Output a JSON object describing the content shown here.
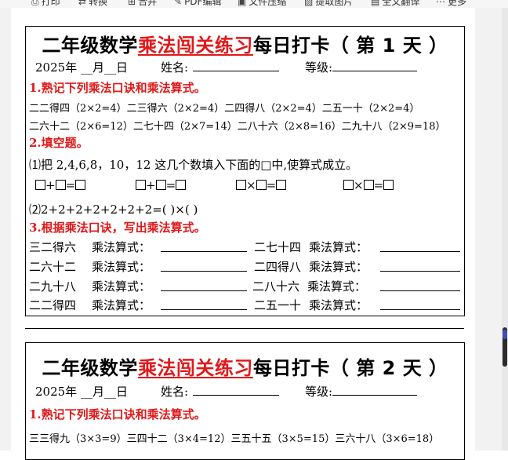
{
  "toolbar": {
    "items": [
      {
        "icon": "print-icon",
        "glyph": "⎙",
        "label": "打印"
      },
      {
        "icon": "convert-icon",
        "glyph": "⇄",
        "label": "转换"
      },
      {
        "icon": "merge-icon",
        "glyph": "⊞",
        "label": "合并"
      },
      {
        "icon": "pdf-edit-icon",
        "glyph": "✎",
        "label": "PDF编辑"
      },
      {
        "icon": "compress-icon",
        "glyph": "▣",
        "label": "文件压缩"
      },
      {
        "icon": "extract-image-icon",
        "glyph": "▨",
        "label": "提取图片"
      },
      {
        "icon": "translate-icon",
        "glyph": "▤",
        "label": "全文翻译"
      },
      {
        "icon": "more-icon",
        "glyph": "⋯",
        "label": "更多"
      }
    ]
  },
  "day1": {
    "title_pre": "二年级数学",
    "title_red": "乘法闯关练习",
    "title_post": "每日打卡（ 第 1 天 ）",
    "date_label": "2025年 __月__日",
    "name_label": "姓名:",
    "grade_label": "等级:",
    "sec1": "1.熟记下列乘法口诀和乘法算式。",
    "row1": "二二得四（2×2=4）二三得六（2×2=4）二四得八（2×2=4）二五一十（2×2=4）",
    "row2": "二六十二（2×6=12）二七十四（2×7=14）二八十六（2×8=16）二九十八（2×9=18）",
    "sec2": "2.填空题。",
    "q1": "⑴把 2,4,6,8，10，12 这几个数填入下面的□中,使算式成立。",
    "eqs": [
      {
        "op1": "+",
        "op2": "="
      },
      {
        "op1": "+",
        "op2": "="
      },
      {
        "op1": "×",
        "op2": "="
      },
      {
        "op1": "×",
        "op2": "="
      }
    ],
    "q2": "⑵2+2+2+2+2+2+2=(      )×(      )",
    "sec3": "3.根据乘法口诀，写出乘法算式。",
    "formulas": [
      {
        "left": "三二得六",
        "right": "二七十四"
      },
      {
        "left": "二六十二",
        "right": "二四得八"
      },
      {
        "left": "二九十八",
        "right": "二八十六"
      },
      {
        "left": "二二得四",
        "right": "二五一十"
      }
    ],
    "formula_label": "乘法算式："
  },
  "day2": {
    "title_pre": "二年级数学",
    "title_red": "乘法闯关练习",
    "title_post": "每日打卡（ 第 2 天 ）",
    "date_label": "2025年 __月__日",
    "name_label": "姓名:",
    "grade_label": "等级:",
    "sec1": "1.熟记下列乘法口诀和乘法算式。",
    "row1": "三三得九（3×3=9）三四十二（3×4=12）三五十五（3×5=15）三六十八（3×6=18）"
  }
}
